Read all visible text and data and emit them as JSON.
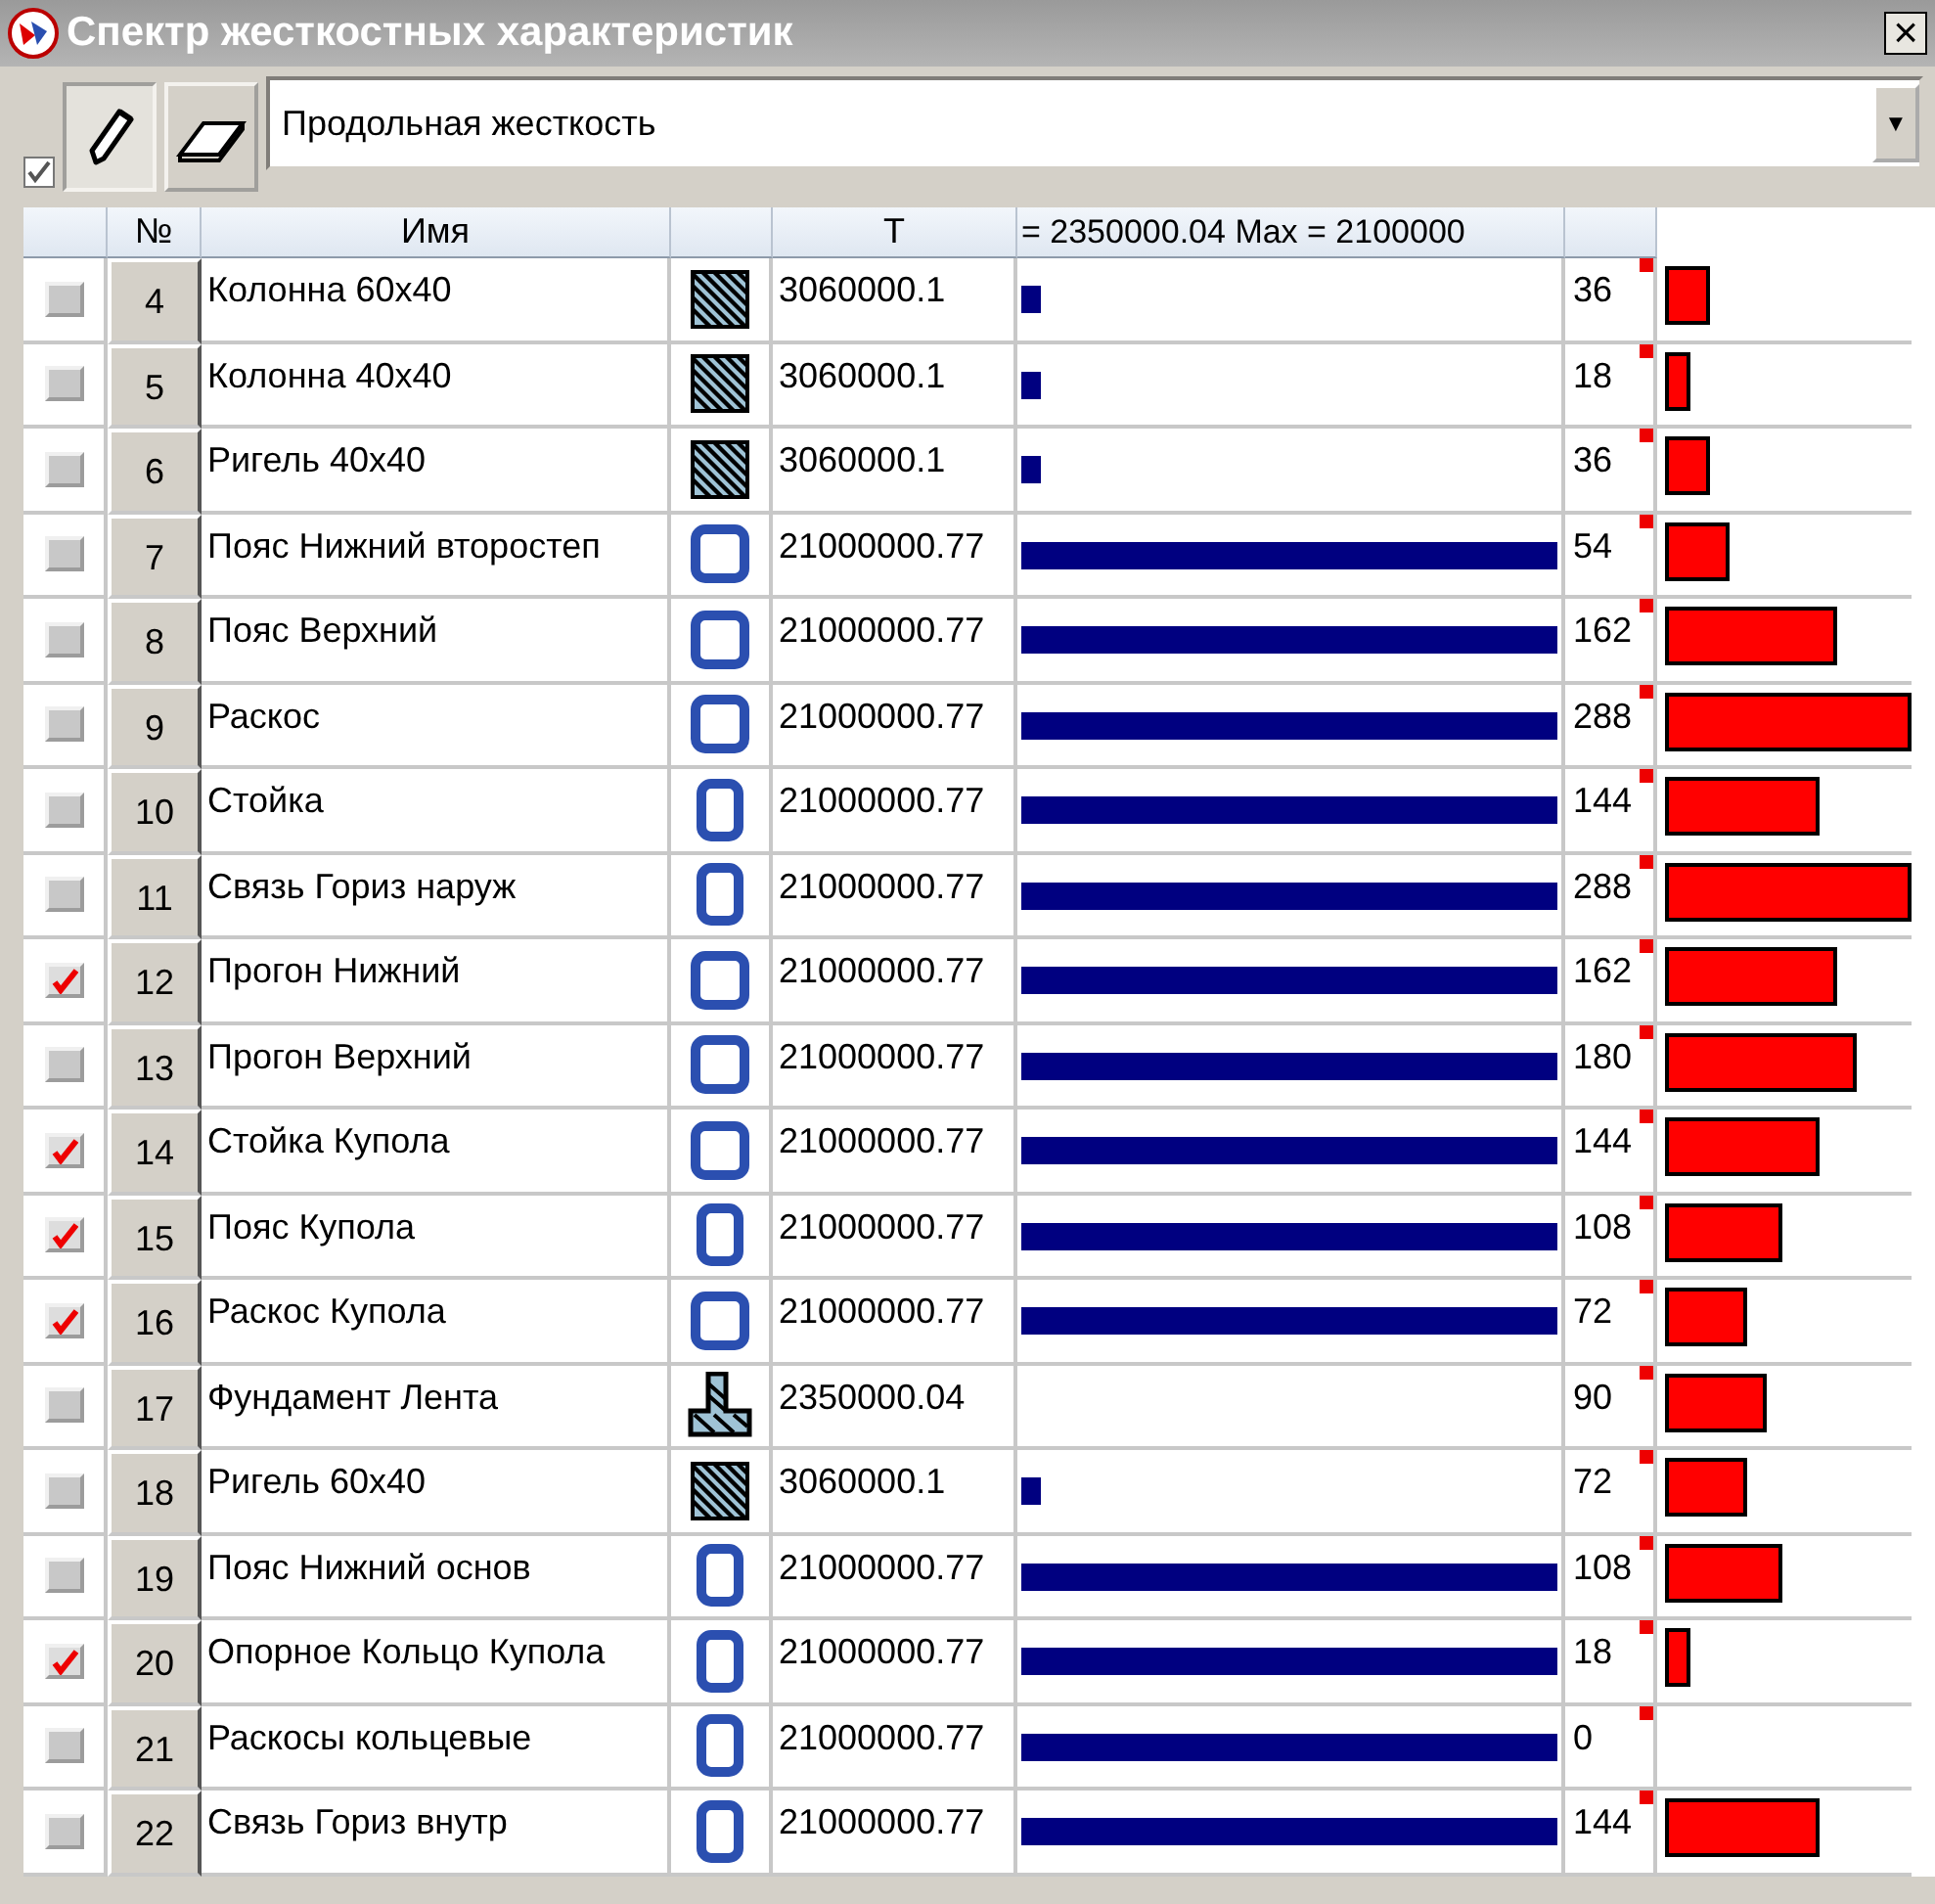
{
  "window": {
    "title": "Спектр жесткостных характеристик",
    "close": "×"
  },
  "toolbar": {
    "checked": true,
    "pencil_pressed": true,
    "dropdown": {
      "value": "Продольная жесткость",
      "arrow": "▼"
    }
  },
  "table": {
    "columns": [
      "",
      "№",
      "Имя",
      "",
      "Т",
      "= 2350000.04 Max = 2100000",
      ""
    ],
    "rows": [
      {
        "checked": false,
        "number": "4",
        "name": "Колонна 60x40",
        "kind": "hatch",
        "t": "3060000.1",
        "t_bar": {
          "level": 0.035
        },
        "value": "36",
        "count_bar": {
          "level": 0.18
        }
      },
      {
        "checked": false,
        "number": "5",
        "name": "Колонна 40x40",
        "kind": "hatch",
        "t": "3060000.1",
        "t_bar": {
          "level": 0.035
        },
        "value": "18",
        "count_bar": {
          "level": 0.1
        }
      },
      {
        "checked": false,
        "number": "6",
        "name": "Ригель 40x40",
        "kind": "hatch",
        "t": "3060000.1",
        "t_bar": {
          "level": 0.035
        },
        "value": "36",
        "count_bar": {
          "level": 0.18
        }
      },
      {
        "checked": false,
        "number": "7",
        "name": "Пояс Нижний второстеп",
        "kind": "box",
        "t": "21000000.77",
        "t_bar": {
          "level": 1
        },
        "value": "54",
        "count_bar": {
          "level": 0.26
        }
      },
      {
        "checked": false,
        "number": "8",
        "name": "Пояс Верхний",
        "kind": "box",
        "t": "21000000.77",
        "t_bar": {
          "level": 1
        },
        "value": "162",
        "count_bar": {
          "level": 0.7
        }
      },
      {
        "checked": false,
        "number": "9",
        "name": "Раскос",
        "kind": "box",
        "t": "21000000.77",
        "t_bar": {
          "level": 1
        },
        "value": "288",
        "count_bar": {
          "level": 1
        }
      },
      {
        "checked": false,
        "number": "10",
        "name": "Стойка",
        "kind": "tube",
        "t": "21000000.77",
        "t_bar": {
          "level": 1
        },
        "value": "144",
        "count_bar": {
          "level": 0.63
        }
      },
      {
        "checked": false,
        "number": "11",
        "name": "Связь Гориз наруж",
        "kind": "tube",
        "t": "21000000.77",
        "t_bar": {
          "level": 1
        },
        "value": "288",
        "count_bar": {
          "level": 1
        }
      },
      {
        "checked": true,
        "number": "12",
        "name": "Прогон Нижний",
        "kind": "box",
        "t": "21000000.77",
        "t_bar": {
          "level": 1
        },
        "value": "162",
        "count_bar": {
          "level": 0.7
        }
      },
      {
        "checked": false,
        "number": "13",
        "name": "Прогон Верхний",
        "kind": "box",
        "t": "21000000.77",
        "t_bar": {
          "level": 1
        },
        "value": "180",
        "count_bar": {
          "level": 0.78
        }
      },
      {
        "checked": true,
        "number": "14",
        "name": "Стойка Купола",
        "kind": "box",
        "t": "21000000.77",
        "t_bar": {
          "level": 1
        },
        "value": "144",
        "count_bar": {
          "level": 0.63
        }
      },
      {
        "checked": true,
        "number": "15",
        "name": "Пояс Купола",
        "kind": "tube",
        "t": "21000000.77",
        "t_bar": {
          "level": 1
        },
        "value": "108",
        "count_bar": {
          "level": 0.48
        }
      },
      {
        "checked": true,
        "number": "16",
        "name": "Раскос Купола",
        "kind": "box",
        "t": "21000000.77",
        "t_bar": {
          "level": 1
        },
        "value": "72",
        "count_bar": {
          "level": 0.33
        }
      },
      {
        "checked": false,
        "number": "17",
        "name": "Фундамент Лента",
        "kind": "foundation",
        "t": "2350000.04",
        "value": "90",
        "count_bar": {
          "level": 0.41
        }
      },
      {
        "checked": false,
        "number": "18",
        "name": "Ригель 60x40",
        "kind": "hatch",
        "t": "3060000.1",
        "t_bar": {
          "level": 0.035
        },
        "value": "72",
        "count_bar": {
          "level": 0.33
        }
      },
      {
        "checked": false,
        "number": "19",
        "name": "Пояс Нижний основ",
        "kind": "tube",
        "t": "21000000.77",
        "t_bar": {
          "level": 1
        },
        "value": "108",
        "count_bar": {
          "level": 0.48
        }
      },
      {
        "checked": true,
        "number": "20",
        "name": "Опорное Кольцо Купола",
        "kind": "tube",
        "t": "21000000.77",
        "t_bar": {
          "level": 1
        },
        "value": "18",
        "count_bar": {
          "level": 0.1
        }
      },
      {
        "checked": false,
        "number": "21",
        "name": "Раскосы кольцевые",
        "kind": "tube",
        "t": "21000000.77",
        "t_bar": {
          "level": 1
        },
        "value": "0"
      },
      {
        "checked": false,
        "number": "22",
        "name": "Связь Гориз внутр",
        "kind": "tube",
        "t": "21000000.77",
        "t_bar": {
          "level": 1
        },
        "value": "144",
        "count_bar": {
          "level": 0.63
        }
      }
    ]
  }
}
